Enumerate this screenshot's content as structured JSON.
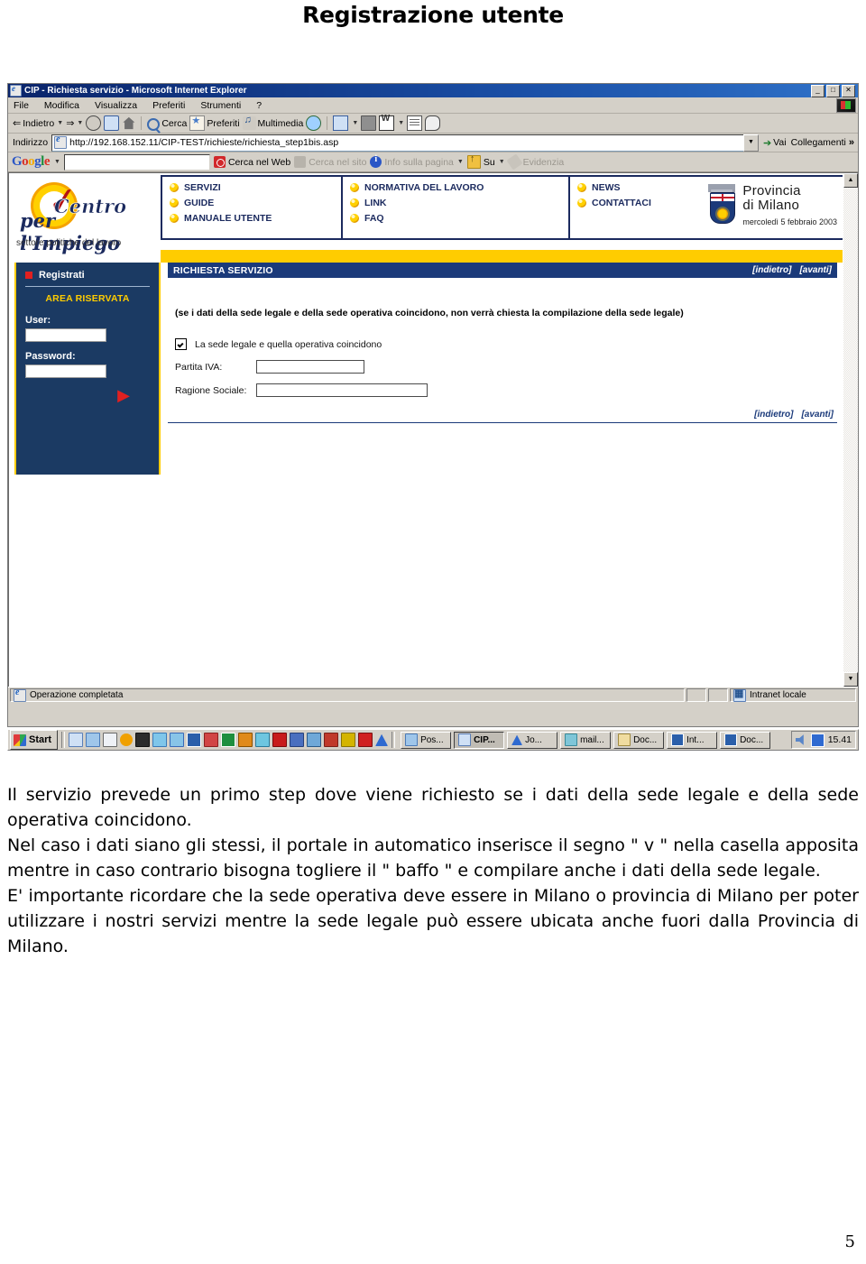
{
  "document": {
    "title": "Registrazione utente",
    "page_number": "5",
    "paragraphs": [
      "Il servizio prevede un primo step dove viene richiesto se i dati della sede legale e della sede operativa coincidono.",
      "Nel caso i dati siano gli stessi, il portale in automatico inserisce il segno \" v \" nella casella apposita mentre in caso contrario bisogna togliere il \" baffo \" e compilare anche i dati della sede legale.",
      "E' importante ricordare che la sede operativa deve essere in Milano o provincia di Milano per poter utilizzare i nostri servizi mentre la sede legale può essere ubicata anche fuori dalla Provincia di Milano."
    ]
  },
  "browser": {
    "title": "CIP - Richiesta servizio - Microsoft Internet Explorer",
    "window_buttons": [
      "_",
      "□",
      "✕"
    ],
    "menu": [
      "File",
      "Modifica",
      "Visualizza",
      "Preferiti",
      "Strumenti",
      "?"
    ],
    "toolbar": {
      "back": "Indietro",
      "forward_icon": "forward-arrow-icon",
      "stop_icon": "stop-icon",
      "refresh_icon": "refresh-icon",
      "home_icon": "home-icon",
      "search": "Cerca",
      "favorites": "Preferiti",
      "media": "Multimedia",
      "history_icon": "history-icon",
      "mail_icon": "mail-icon",
      "print_icon": "print-icon",
      "edit_word_icon": "edit-in-word-icon",
      "discuss_icon": "discussions-icon",
      "messenger_icon": "messenger-icon"
    },
    "address": {
      "label": "Indirizzo",
      "value": "http://192.168.152.11/CIP-TEST/richieste/richiesta_step1bis.asp",
      "go": "Vai",
      "links": "Collegamenti"
    },
    "google_toolbar": {
      "logo": [
        "G",
        "o",
        "o",
        "g",
        "l",
        "e"
      ],
      "search_value": "",
      "buttons": [
        {
          "label": "Cerca nel Web",
          "icon": "google-web-search-icon",
          "dim": false
        },
        {
          "label": "Cerca nel sito",
          "icon": "google-site-search-icon",
          "dim": true
        },
        {
          "label": "Info sulla pagina",
          "icon": "page-info-icon",
          "dim": true
        },
        {
          "label": "Su",
          "icon": "up-folder-icon",
          "dim": false
        },
        {
          "label": "Evidenzia",
          "icon": "highlight-icon",
          "dim": true
        }
      ]
    },
    "status": {
      "message": "Operazione completata",
      "zone": "Intranet locale"
    }
  },
  "site": {
    "logo": {
      "word1": "Centro",
      "word2": "per l'Impiego",
      "subtitle": "settore politiche del lavoro"
    },
    "nav_columns": [
      {
        "links": [
          "SERVIZI",
          "GUIDE",
          "MANUALE UTENTE"
        ]
      },
      {
        "links": [
          "NORMATIVA DEL LAVORO",
          "LINK",
          "FAQ"
        ]
      },
      {
        "links": [
          "NEWS",
          "CONTATTACI"
        ]
      }
    ],
    "province": {
      "line1": "Provincia",
      "line2": "di Milano",
      "date": "mercoledì 5 febbraio 2003"
    },
    "sidebar": {
      "registrati": "Registrati",
      "area": "AREA RISERVATA",
      "user_label": "User:",
      "user_value": "",
      "password_label": "Password:",
      "password_value": "",
      "submit_icon": "red-play-arrow-icon"
    },
    "main": {
      "bar_title": "RICHIESTA SERVIZIO",
      "nav_back": "[indietro]",
      "nav_next": "[avanti]",
      "note": "(se i dati della sede legale e della sede operativa coincidono, non verrà chiesta la compilazione della sede legale)",
      "checkbox_label": "La sede legale e quella operativa coincidono",
      "checkbox_checked": true,
      "fields": [
        {
          "label": "Partita IVA:",
          "value": ""
        },
        {
          "label": "Ragione Sociale:",
          "value": ""
        }
      ],
      "bottom_back": "[indietro]",
      "bottom_next": "[avanti]"
    }
  },
  "taskbar": {
    "start": "Start",
    "quick_icons": [
      "ie-icon",
      "outlook-icon",
      "show-desktop-icon",
      "media-player-icon",
      "app-icon-1",
      "app-icon-2",
      "app-icon-3",
      "word-icon",
      "app-icon-4",
      "excel-icon",
      "app-icon-5",
      "app-icon-6",
      "acrobat-icon",
      "app-icon-7",
      "app-icon-8",
      "app-icon-9",
      "app-icon-10",
      "app-icon-11",
      "app-icon-12"
    ],
    "tasks": [
      {
        "label": "Pos...",
        "icon": "outlook-icon",
        "active": false
      },
      {
        "label": "CIP...",
        "icon": "ie-icon",
        "active": true
      },
      {
        "label": "Jo...",
        "icon": "triangle-icon",
        "active": false
      },
      {
        "label": "mail...",
        "icon": "mail-icon",
        "active": false
      },
      {
        "label": "Doc...",
        "icon": "folder-icon",
        "active": false
      },
      {
        "label": "Int...",
        "icon": "word-icon",
        "active": false
      },
      {
        "label": "Doc...",
        "icon": "word-icon",
        "active": false
      }
    ],
    "tray_icons": [
      "volume-icon",
      "language-icon"
    ],
    "clock": "15.41"
  },
  "colors": {
    "brand_blue": "#1b3a7a",
    "brand_yellow": "#ffcc00",
    "sidebar_blue": "#1b3a63",
    "accent_red": "#e02020"
  }
}
